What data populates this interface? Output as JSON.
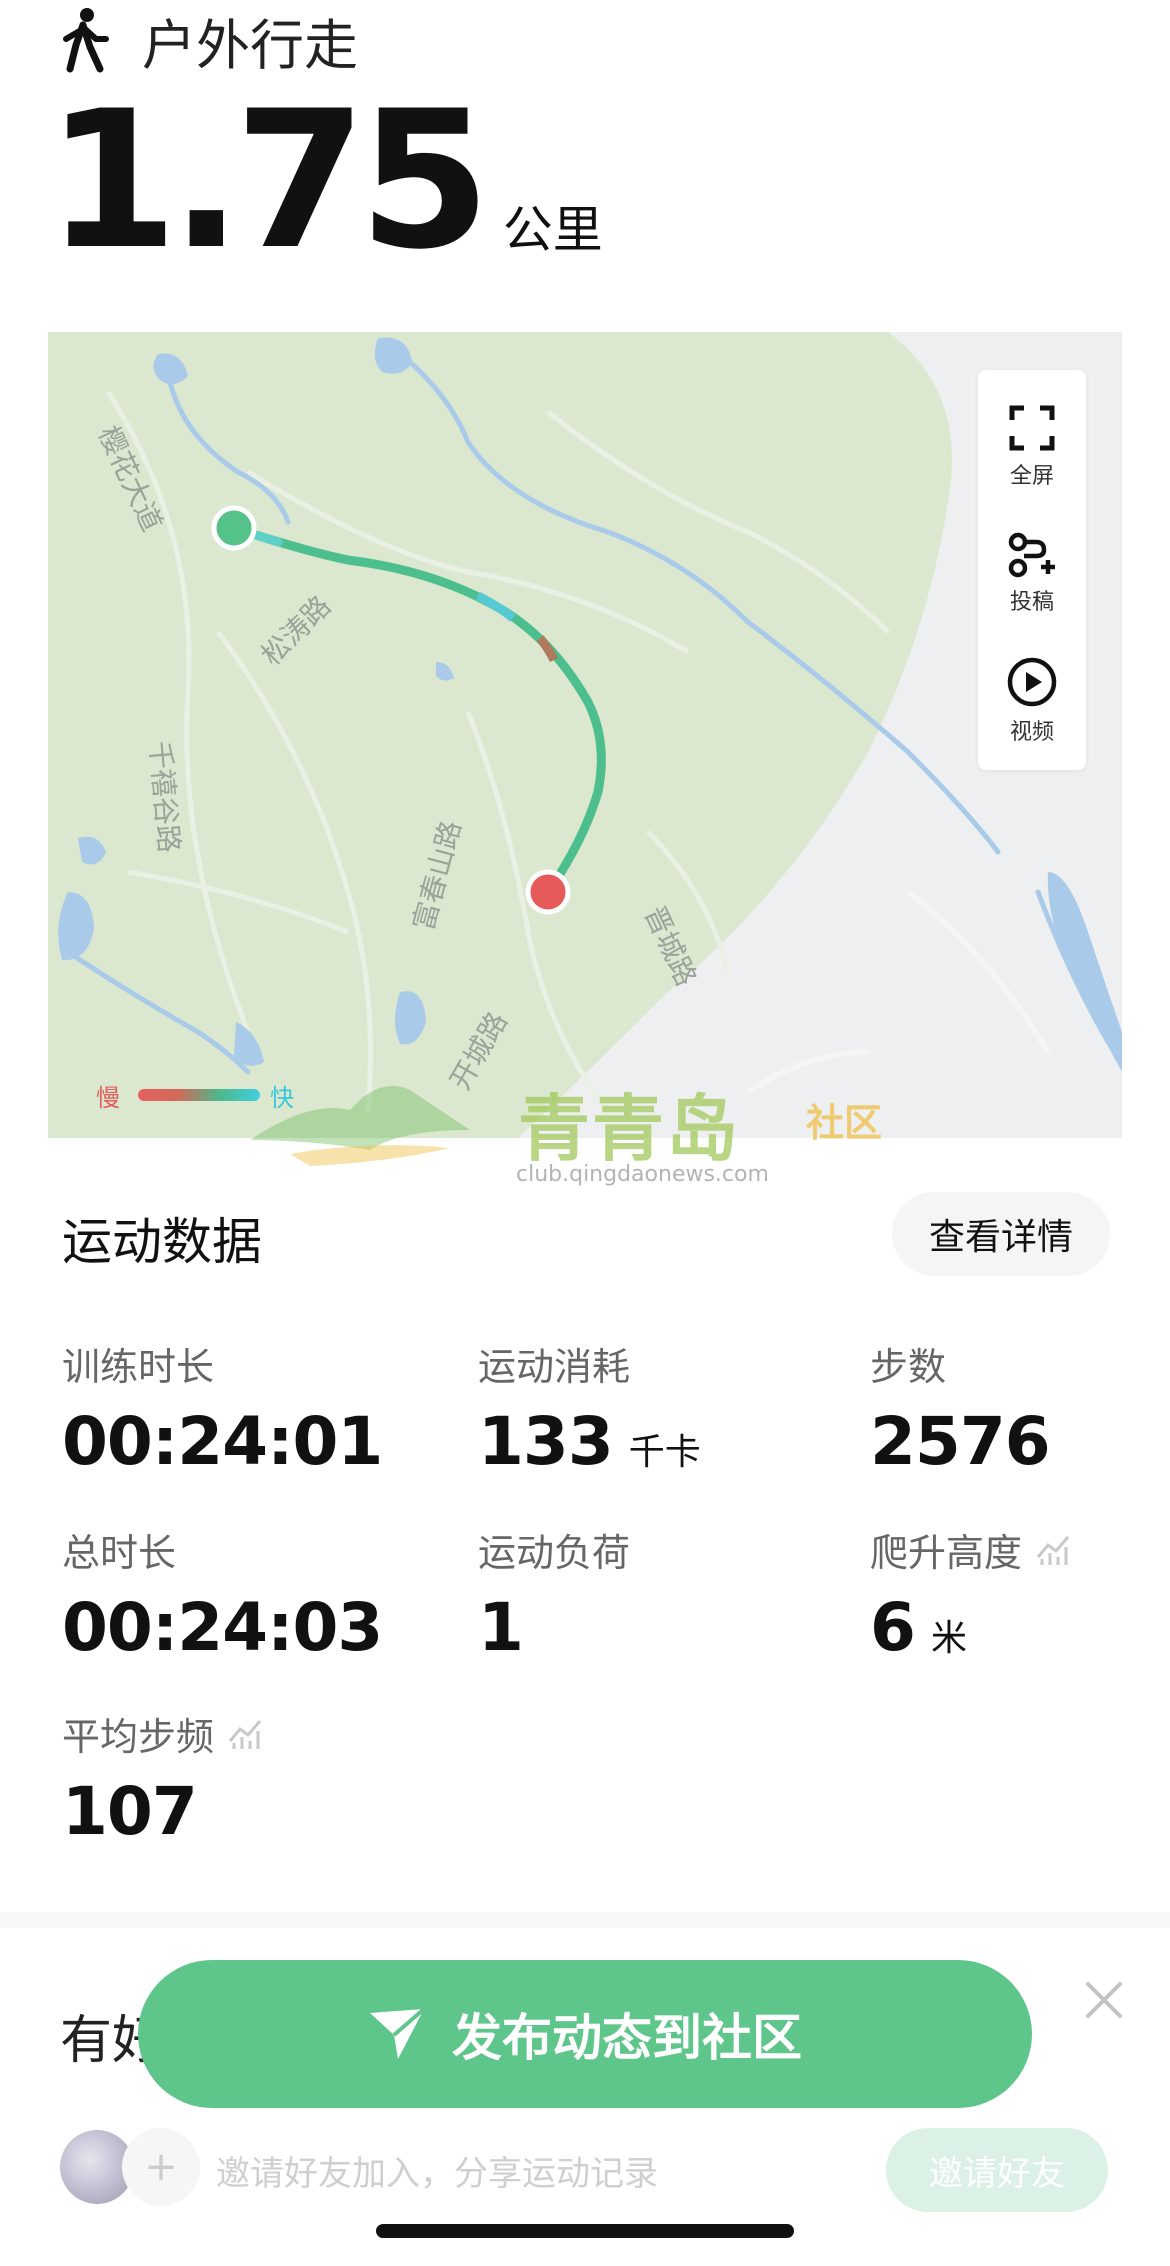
{
  "header": {
    "activity_type": "户外行走",
    "distance_value": "1.75",
    "distance_unit": "公里"
  },
  "map": {
    "controls": [
      {
        "icon": "fullscreen-icon",
        "label": "全屏"
      },
      {
        "icon": "route-share-icon",
        "label": "投稿"
      },
      {
        "icon": "play-icon",
        "label": "视频"
      }
    ],
    "road_labels": [
      "樱花大道",
      "松涛路",
      "千禧谷路",
      "富春山路",
      "开城路",
      "晋城路"
    ],
    "legend": {
      "slow": "慢",
      "fast": "快"
    },
    "colors": {
      "route_slow": "#e56060",
      "route_fast": "#3fd0e0",
      "route_main": "#4dbf8e",
      "start_marker": "#55c28a",
      "end_marker": "#e65a5a",
      "park_area": "#dbe8cf",
      "water": "#a9cbe9"
    }
  },
  "watermark": {
    "brand": "青青岛",
    "tag": "社区",
    "url": "club.qingdaonews.com"
  },
  "stats_section": {
    "title": "运动数据",
    "details_button": "查看详情",
    "items": [
      {
        "label": "训练时长",
        "value": "00:24:01",
        "unit": ""
      },
      {
        "label": "运动消耗",
        "value": "133",
        "unit": "千卡"
      },
      {
        "label": "步数",
        "value": "2576",
        "unit": ""
      },
      {
        "label": "总时长",
        "value": "00:24:03",
        "unit": ""
      },
      {
        "label": "运动负荷",
        "value": "1",
        "unit": ""
      },
      {
        "label": "爬升高度",
        "value": "6",
        "unit": "米"
      },
      {
        "label": "平均步频",
        "value": "107",
        "unit": ""
      }
    ]
  },
  "friends_section": {
    "title_partial": "有好",
    "invite_placeholder": "邀请好友加入，分享运动记录",
    "invite_button": "邀请好友"
  },
  "publish_button": {
    "label": "发布动态到社区",
    "color": "#5fc68b"
  }
}
